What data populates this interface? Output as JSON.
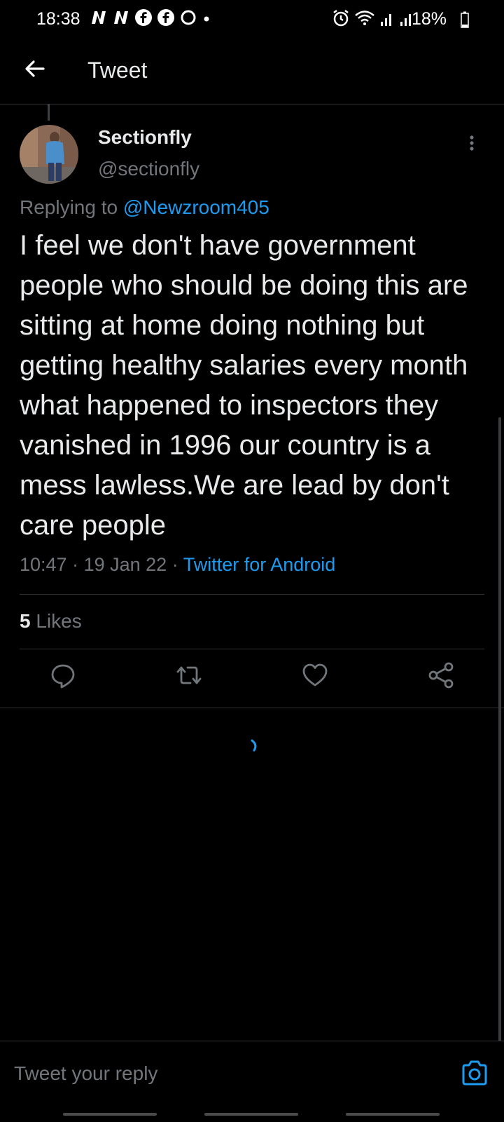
{
  "status_bar": {
    "time": "18:38",
    "battery_percent": "18%",
    "notification_icons": [
      "n-icon",
      "n-icon",
      "facebook-icon",
      "facebook-icon",
      "circle-icon",
      "dot-icon"
    ],
    "system_icons": [
      "alarm-icon",
      "wifi-icon",
      "signal-icon",
      "signal-icon"
    ]
  },
  "header": {
    "title": "Tweet"
  },
  "tweet": {
    "display_name": "Sectionfly",
    "handle": "@sectionfly",
    "replying_prefix": "Replying to ",
    "replying_mention": "@Newzroom405",
    "text": "I feel we don't have government people who should be doing this are sitting at home doing nothing but getting healthy salaries every month what happened to inspectors  they vanished in 1996 our country is a mess lawless.We are lead by don't care people",
    "time": "10:47",
    "date": "19 Jan 22",
    "separator": " · ",
    "source": "Twitter for Android",
    "likes_count": "5",
    "likes_label": " Likes"
  },
  "reply_box": {
    "placeholder": "Tweet your reply"
  },
  "colors": {
    "accent": "#1d9bf0",
    "background": "#000000",
    "muted": "#71767b"
  }
}
